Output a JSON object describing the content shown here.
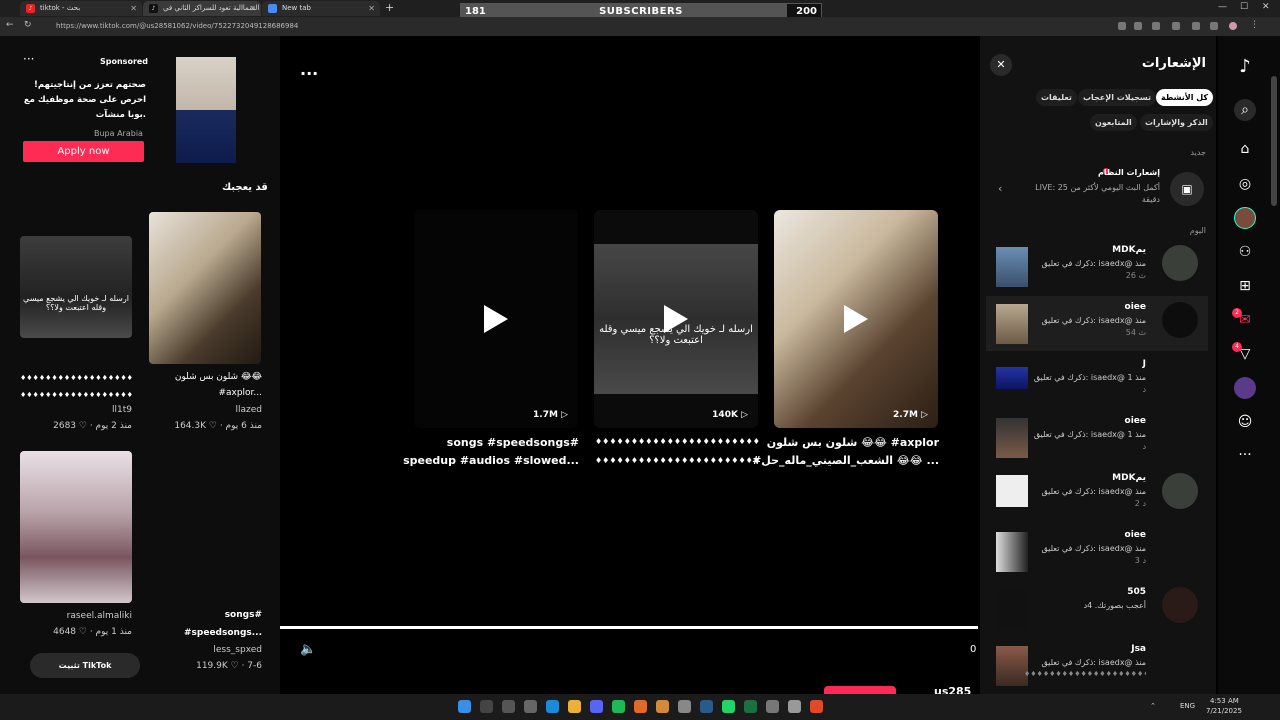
{
  "browser": {
    "tabs": [
      {
        "label": "tiktok - بحث",
        "icon": "tiktok-icon"
      },
      {
        "label": "دبة الشماالية تعود للسراكز الثاني في",
        "icon": "tiktok-icon"
      },
      {
        "label": "New tab",
        "icon": "chrome-icon"
      }
    ],
    "url": "https://www.tiktok.com/@us28581062/video/7522732049128686984",
    "subscribers": {
      "label": "SUBSCRIBERS",
      "current": "181",
      "goal": "200",
      "progress": 0.905
    }
  },
  "ad": {
    "sponsored": "Sponsored",
    "text": "صحتهم تعزز من إنتاجيتهم! احرص على صحة موظفيك مع بوبا منشآت.",
    "brand": "Bupa Arabia",
    "cta": "Apply now"
  },
  "left": {
    "heading": "قد يعجبك",
    "items": [
      {
        "title1": "شلون بس شلون 😂😂",
        "title2": "#axplor...",
        "user": "llazed",
        "stats": "164.3K ♡ · منذ 6 يوم",
        "overlay": ""
      },
      {
        "title1": "♦♦♦♦♦♦♦♦♦♦♦♦♦♦♦♦♦♦♦♦♦♦",
        "title2": "♦♦♦♦♦♦♦♦♦♦♦♦♦♦♦♦♦♦♦♦♦♦",
        "user": "ll1t9",
        "stats": "2683 ♡ · منذ 2 يوم",
        "overlay": "ارسله لـ خويك الي يشجع ميسي وقله اعتبعت ولا؟؟"
      },
      {
        "title1": "",
        "title2": "",
        "user": "raseel.almaliki",
        "stats": "4648 ♡ · منذ 1 يوم",
        "overlay": ""
      },
      {
        "title1": "songs#",
        "title2": "#speedsongs...",
        "user": "less_spxed",
        "stats": "119.9K ♡ · 7-6",
        "overlay": ""
      }
    ],
    "get_app": "تثبيت TikTok"
  },
  "main": {
    "cards": [
      {
        "views": "1.7M",
        "title1": "songs #speedsongs#",
        "title2": "speedup #audios #slowed..."
      },
      {
        "views": "140K",
        "title1": "♦♦♦♦♦♦♦♦♦♦♦♦♦♦♦♦♦♦♦♦♦♦♦",
        "title2": "♦♦♦♦♦♦♦♦♦♦♦♦♦♦♦♦♦♦♦♦♦♦♦#...",
        "overlay": "ارسله لـ خويك الي يشجع ميسي وقله اعتبعت ولا؟؟"
      },
      {
        "views": "2.7M",
        "title1": "شلون بس شلون 😂😂 #axplor",
        "title2": "#الشعب_الصيني_ماله_حل 😂😂 ..."
      }
    ],
    "time": "0",
    "username": "us285"
  },
  "notifications": {
    "title": "الإشعارات",
    "filters": [
      "كل الأنشطة",
      "تسجيلات الإعجاب",
      "تعليقات",
      "الذكر والإشارات",
      "المتابعون"
    ],
    "section_new": "جديد",
    "system_title": "إشعارات النظام",
    "system_desc": "LIVE: أكمل البث اليومي لأكثر من 25 دقيقة",
    "section_today": "اليوم",
    "items": [
      {
        "name": "MDKيم",
        "msg": "ذكرك في تعليق: isaedx@ منذ",
        "time": "26 ث"
      },
      {
        "name": "oiee",
        "msg": "ذكرك في تعليق: isaedx@ منذ",
        "time": "54 ث"
      },
      {
        "name": "J",
        "msg": "ذكرك في تعليق: isaedx@ منذ 1",
        "time": "د"
      },
      {
        "name": "oiee",
        "msg": "ذكرك في تعليق: isaedx@ منذ 1",
        "time": "د"
      },
      {
        "name": "MDKيم",
        "msg": "ذكرك في تعليق: isaedx@ منذ",
        "time": "2 د"
      },
      {
        "name": "oiee",
        "msg": "ذكرك في تعليق: isaedx@ منذ",
        "time": "3 د"
      },
      {
        "name": "505",
        "msg": "أعجب بصورتك. 4د",
        "time": ""
      },
      {
        "name": "Jsa",
        "msg": "ذكرك في تعليق: isaedx@ منذ",
        "time": "♦♦♦♦♦♦♦♦♦♦♦♦♦♦♦♦♦♦♦♦♦"
      }
    ]
  },
  "sidebar": {
    "badges": {
      "messages": "2",
      "activity": "4"
    }
  },
  "taskbar": {
    "lang": "ENG",
    "time": "4:53 AM",
    "date": "7/21/2025"
  },
  "colors": {
    "accent": "#fe2c55",
    "background": "#000000",
    "panel": "#121212"
  }
}
